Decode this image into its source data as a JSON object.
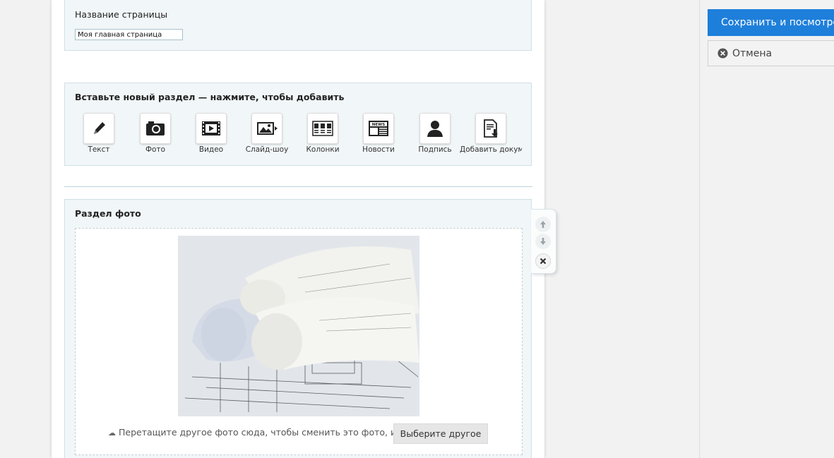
{
  "page_title": {
    "label": "Название страницы",
    "value": "Моя главная страница"
  },
  "insert_section": {
    "heading": "Вставьте новый раздел — нажмите, чтобы добавить",
    "items": [
      {
        "label": "Текст",
        "icon": "pencil-icon"
      },
      {
        "label": "Фото",
        "icon": "camera-icon"
      },
      {
        "label": "Видео",
        "icon": "video-icon"
      },
      {
        "label": "Слайд-шоу",
        "icon": "slideshow-icon"
      },
      {
        "label": "Колонки",
        "icon": "columns-icon"
      },
      {
        "label": "Новости",
        "icon": "newspaper-icon"
      },
      {
        "label": "Подпись",
        "icon": "person-icon"
      },
      {
        "label": "Добавить документ",
        "icon": "document-icon"
      }
    ]
  },
  "photo_section": {
    "heading": "Раздел фото",
    "hint": "Перетащите другое фото сюда, чтобы сменить это фото, или",
    "choose_label": "Выберите другое"
  },
  "actions": {
    "save_label": "Сохранить и посмотреть",
    "cancel_label": "Отмена",
    "accent": "#1e7fdb"
  }
}
